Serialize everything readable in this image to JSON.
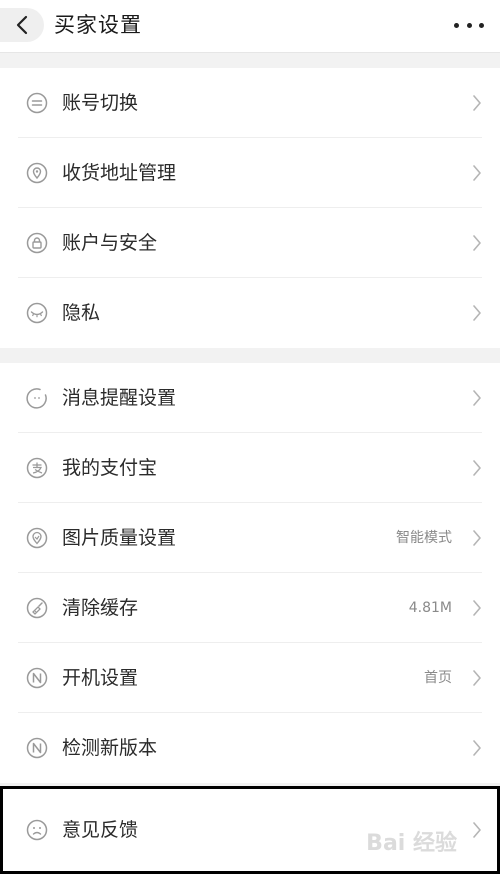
{
  "header": {
    "title": "买家设置",
    "back_icon": "back-chevron-icon",
    "more_icon": "more-dots-icon"
  },
  "group1": {
    "items": [
      {
        "label": "账号切换",
        "icon": "switch-account-icon",
        "value": ""
      },
      {
        "label": "收货地址管理",
        "icon": "location-pin-icon",
        "value": ""
      },
      {
        "label": "账户与安全",
        "icon": "lock-icon",
        "value": ""
      },
      {
        "label": "隐私",
        "icon": "eye-closed-icon",
        "value": ""
      }
    ]
  },
  "group2": {
    "items": [
      {
        "label": "消息提醒设置",
        "icon": "notification-icon",
        "value": ""
      },
      {
        "label": "我的支付宝",
        "icon": "alipay-icon",
        "value": ""
      },
      {
        "label": "图片质量设置",
        "icon": "image-quality-icon",
        "value": "智能模式"
      },
      {
        "label": "清除缓存",
        "icon": "clear-cache-icon",
        "value": "4.81M"
      },
      {
        "label": "开机设置",
        "icon": "startup-icon",
        "value": "首页"
      },
      {
        "label": "检测新版本",
        "icon": "version-icon",
        "value": ""
      }
    ]
  },
  "feedback": {
    "label": "意见反馈",
    "icon": "sad-face-icon"
  },
  "watermark": "Bai 经验",
  "colors": {
    "background": "#f2f2f2",
    "card": "#ffffff",
    "text": "#2b2b2b",
    "secondary_text": "#8a8a8a",
    "icon": "#9a9a9a",
    "highlight_border": "#000000"
  }
}
